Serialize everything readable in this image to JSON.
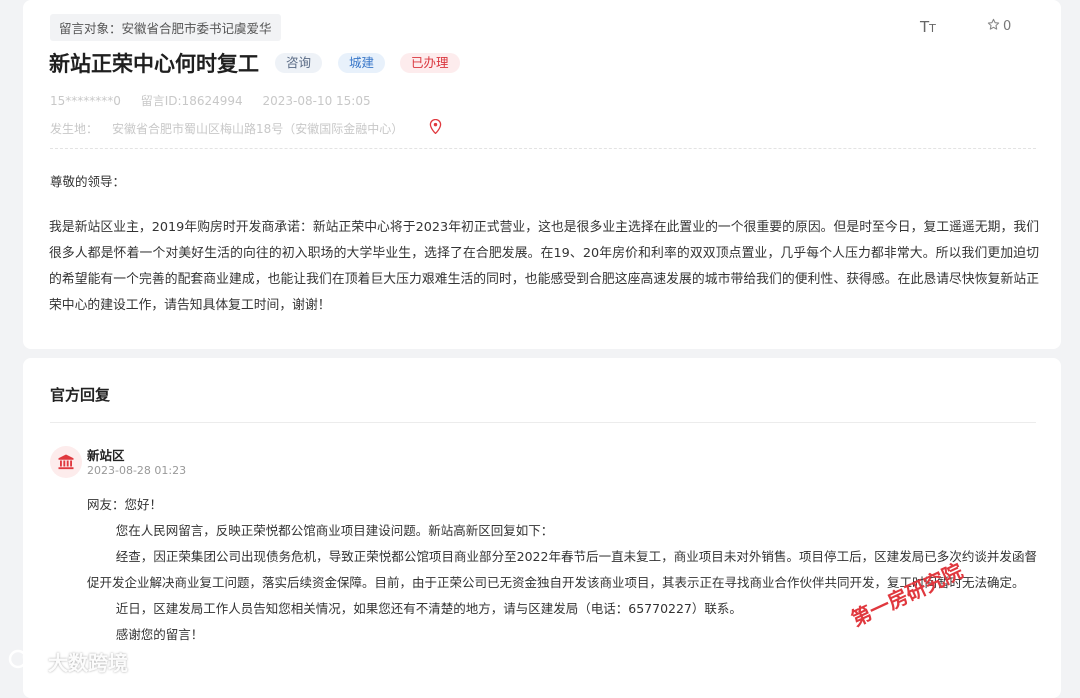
{
  "header": {
    "target_tag": "留言对象：安徽省合肥市委书记虞爱华",
    "font_tool": "TT",
    "fav_count": "0"
  },
  "message": {
    "title": "新站正荣中心何时复工",
    "badges": [
      "咨询",
      "城建",
      "已办理"
    ],
    "meta": {
      "user": "15********0",
      "id": "留言ID:18624994",
      "time": "2023-08-10 15:05",
      "location_label": "发生地：",
      "location": "安徽省合肥市蜀山区梅山路18号（安徽国际金融中心）"
    },
    "greeting": "尊敬的领导：",
    "body": "我是新站区业主，2019年购房时开发商承诺：新站正荣中心将于2023年初正式营业，这也是很多业主选择在此置业的一个很重要的原因。但是时至今日，复工遥遥无期，我们很多人都是怀着一个对美好生活的向往的初入职场的大学毕业生，选择了在合肥发展。在19、20年房价和利率的双双顶点置业，几乎每个人压力都非常大。所以我们更加迫切的希望能有一个完善的配套商业建成，也能让我们在顶着巨大压力艰难生活的同时，也能感受到合肥这座高速发展的城市带给我们的便利性、获得感。在此恳请尽快恢复新站正荣中心的建设工作，请告知具体复工时间，谢谢！"
  },
  "reply": {
    "section_title": "官方回复",
    "org_name": "新站区",
    "date": "2023-08-28 01:23",
    "lines": [
      "网友：您好！",
      "您在人民网留言，反映正荣悦都公馆商业项目建设问题。新站高新区回复如下：",
      "经查，因正荣集团公司出现债务危机，导致正荣悦都公馆项目商业部分至2022年春节后一直未复工，商业项目未对外销售。项目停工后，区建发局已多次约谈并发函督促开发企业解决商业复工问题，落实后续资金保障。目前，由于正荣公司已无资金独自开发该商业项目，其表示正在寻找商业合作伙伴共同开发，复工时间暂时无法确定。",
      "近日，区建发局工作人员告知您相关情况，如果您还有不清楚的地方，请与区建发局（电话：65770227）联系。",
      "感谢您的留言！"
    ]
  },
  "watermarks": {
    "left": "大数跨境",
    "red": "第一房研究院"
  },
  "colors": {
    "accent_red": "#d9363e",
    "accent_blue": "#3a78c9"
  }
}
